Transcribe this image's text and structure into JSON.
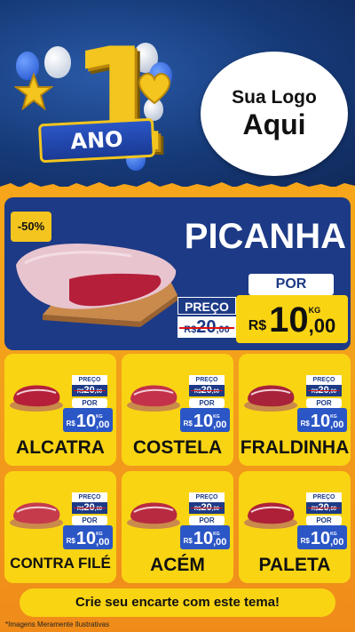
{
  "header": {
    "anniversary_number": "1",
    "anniversary_label": "ANO",
    "logo_line1": "Sua Logo",
    "logo_line2": "Aqui"
  },
  "hero": {
    "discount": "-50%",
    "name": "PICANHA",
    "preco_label": "PREÇO",
    "old_currency": "R$",
    "old_value": "20",
    "old_cents": ",00",
    "por_label": "POR",
    "unit": "KG",
    "currency": "R$",
    "value": "10",
    "cents": ",00"
  },
  "products": [
    {
      "name": "ALCATRA",
      "preco_label": "PREÇO",
      "old_currency": "R$",
      "old_value": "20",
      "old_cents": ",00",
      "por_label": "POR",
      "unit": "KG",
      "currency": "R$",
      "value": "10",
      "cents": ",00"
    },
    {
      "name": "COSTELA",
      "preco_label": "PREÇO",
      "old_currency": "R$",
      "old_value": "20",
      "old_cents": ",00",
      "por_label": "POR",
      "unit": "KG",
      "currency": "R$",
      "value": "10",
      "cents": ",00"
    },
    {
      "name": "FRALDINHA",
      "preco_label": "PREÇO",
      "old_currency": "R$",
      "old_value": "20",
      "old_cents": ",00",
      "por_label": "POR",
      "unit": "KG",
      "currency": "R$",
      "value": "10",
      "cents": ",00"
    },
    {
      "name": "CONTRA FILÉ",
      "preco_label": "PREÇO",
      "old_currency": "R$",
      "old_value": "20",
      "old_cents": ",00",
      "por_label": "POR",
      "unit": "KG",
      "currency": "R$",
      "value": "10",
      "cents": ",00"
    },
    {
      "name": "ACÉM",
      "preco_label": "PREÇO",
      "old_currency": "R$",
      "old_value": "20",
      "old_cents": ",00",
      "por_label": "POR",
      "unit": "KG",
      "currency": "R$",
      "value": "10",
      "cents": ",00"
    },
    {
      "name": "PALETA",
      "preco_label": "PREÇO",
      "old_currency": "R$",
      "old_value": "20",
      "old_cents": ",00",
      "por_label": "POR",
      "unit": "KG",
      "currency": "R$",
      "value": "10",
      "cents": ",00"
    }
  ],
  "footer": {
    "cta": "Crie seu encarte com este tema!",
    "disclaimer": "*Imagens Meramente Ilustrativas"
  },
  "colors": {
    "navy": "#1d3a86",
    "yellow": "#f9d413",
    "orange": "#f3a11b",
    "gold": "#f3c51e"
  }
}
